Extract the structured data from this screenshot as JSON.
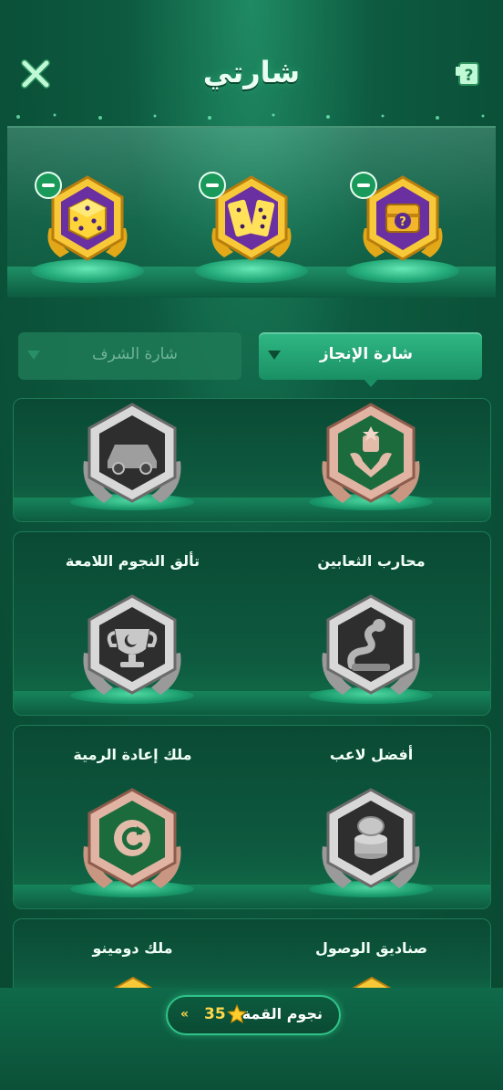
{
  "header": {
    "title": "شارتي",
    "close_icon": "close-icon",
    "help_icon": "help-icon"
  },
  "equipped_badges": [
    {
      "icon": "treasure-chest-icon",
      "frame": "gold-purple"
    },
    {
      "icon": "domino-icon",
      "frame": "gold-purple"
    },
    {
      "icon": "dice-icon",
      "frame": "gold-purple"
    }
  ],
  "tabs": {
    "achievement": "شارة الإنجاز",
    "honor": "شارة الشرف"
  },
  "badges": [
    {
      "label": "",
      "icon": "trophy-wings-icon",
      "tier": "bronze"
    },
    {
      "label": "",
      "icon": "car-icon",
      "tier": "silver"
    },
    {
      "label": "محارب الثعابين",
      "icon": "snake-icon",
      "tier": "silver"
    },
    {
      "label": "تألق النجوم اللامعة",
      "icon": "trophy-cup-icon",
      "tier": "silver"
    },
    {
      "label": "أفضل لاعب",
      "icon": "coins-icon",
      "tier": "silver"
    },
    {
      "label": "ملك إعادة الرمية",
      "icon": "reroll-icon",
      "tier": "bronze"
    },
    {
      "label": "صناديق الوصول",
      "icon": "box-icon",
      "tier": "gold"
    },
    {
      "label": "ملك دومينو",
      "icon": "domino-icon",
      "tier": "gold"
    }
  ],
  "footer": {
    "stars_label": "نجوم القمة",
    "stars_count": "35",
    "star_icon": "star-icon",
    "chevron_icon": "double-chevron-icon"
  },
  "colors": {
    "accent": "#2fb884",
    "gold": "#ffd94a",
    "background": "#0d5a40"
  }
}
